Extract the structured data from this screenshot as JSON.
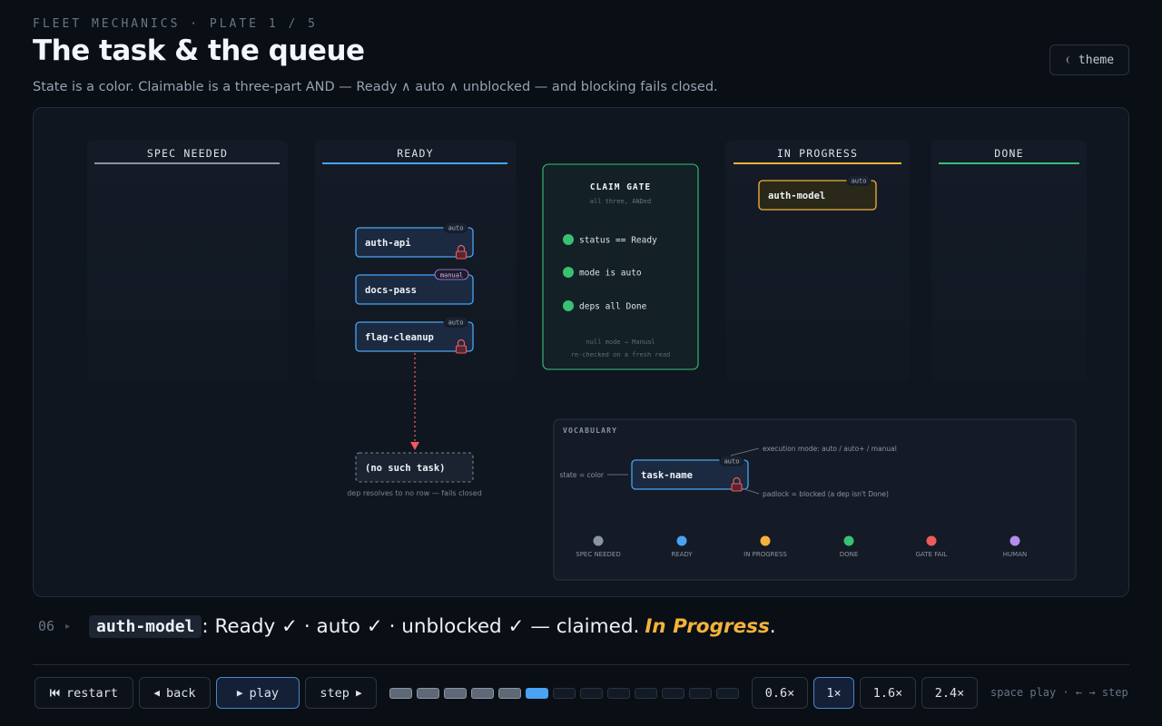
{
  "header": {
    "kicker": "FLEET MECHANICS · PLATE 1 / 5",
    "title": "The task & the queue",
    "subtitle": "State is a color. Claimable is a three-part AND — Ready ∧ auto ∧ unblocked — and blocking fails closed.",
    "theme_label": "theme",
    "theme_icon": "half-moon-icon"
  },
  "board": {
    "columns": [
      {
        "label": "SPEC NEEDED",
        "color": "#8a94a3"
      },
      {
        "label": "READY",
        "color": "#4aa3f2"
      },
      {
        "label": "IN PROGRESS",
        "color": "#f4b23c"
      },
      {
        "label": "DONE",
        "color": "#38c172"
      }
    ],
    "ready_tasks": [
      {
        "name": "auth-api",
        "mode": "auto",
        "blocked": true
      },
      {
        "name": "docs-pass",
        "mode": "manual",
        "blocked": false
      },
      {
        "name": "flag-cleanup",
        "mode": "auto",
        "blocked": true
      }
    ],
    "in_progress_tasks": [
      {
        "name": "auth-model",
        "mode": "auto",
        "blocked": false
      }
    ],
    "ghost_task": {
      "name": "(no such task)",
      "note": "dep resolves to no row — fails closed"
    }
  },
  "gate": {
    "title": "CLAIM GATE",
    "subtitle": "all three, ANDed",
    "checks": [
      "status == Ready",
      "mode is auto",
      "deps all Done"
    ],
    "footnote_1": "null mode → Manual",
    "footnote_2": "re-checked on a fresh read",
    "pass_color": "#38c172"
  },
  "vocab": {
    "title": "VOCABULARY",
    "sample_task": "task-name",
    "sample_mode": "auto",
    "state_label": "state = color",
    "mode_label": "execution mode: auto / auto+ / manual",
    "padlock_label": "padlock = blocked (a dep isn't Done)",
    "legend": [
      {
        "label": "SPEC NEEDED",
        "color": "#8a94a3"
      },
      {
        "label": "READY",
        "color": "#4aa3f2"
      },
      {
        "label": "IN PROGRESS",
        "color": "#f4b23c"
      },
      {
        "label": "DONE",
        "color": "#38c172"
      },
      {
        "label": "GATE FAIL",
        "color": "#ef5b5b"
      },
      {
        "label": "HUMAN",
        "color": "#b68cf0"
      }
    ]
  },
  "caption": {
    "step": "06",
    "task": "auth-model",
    "text": ": Ready ✓ · auto ✓ · unblocked ✓ — claimed.",
    "state": "In Progress",
    "end": "."
  },
  "controls": {
    "restart": "restart",
    "back": "back",
    "play": "play",
    "step": "step",
    "speeds": [
      "0.6×",
      "1×",
      "1.6×",
      "2.4×"
    ],
    "active_speed": "1×",
    "total_steps": 13,
    "current_step": 6,
    "hint": "space play · ← → step"
  }
}
